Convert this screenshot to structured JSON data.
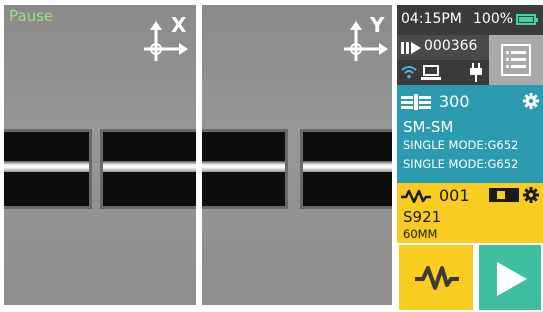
{
  "camera_x": {
    "status_label": "Pause",
    "axis_label": "X",
    "icon": "axis-cross-icon"
  },
  "camera_y": {
    "axis_label": "Y",
    "icon": "axis-cross-icon"
  },
  "status_bar": {
    "time": "04:15PM",
    "battery_percent": "100%",
    "battery_icon": "battery-full-icon",
    "colors": {
      "background": "#3b3b3b",
      "battery": "#3fd6a3"
    }
  },
  "info": {
    "splice_count": "000366",
    "counter_icon": "arc-counter-icon",
    "connection_icons": [
      "wifi-icon",
      "laptop-icon",
      "power-plug-icon"
    ]
  },
  "menu_button": {
    "icon": "menu-list-icon"
  },
  "splice_program": {
    "number": "300",
    "mode": "SM-SM",
    "left_fiber": "SINGLE MODE:G652",
    "right_fiber": "SINGLE MODE:G652",
    "icon": "splice-mode-icon",
    "settings_icon": "gear-icon",
    "color": "#2c9bb0"
  },
  "heater_program": {
    "number": "001",
    "name": "S921",
    "length": "60MM",
    "icon": "heat-wave-icon",
    "heater_icon": "heater-slot-icon",
    "settings_icon": "gear-icon",
    "color": "#f8cc21"
  },
  "buttons": {
    "heat_icon": "heat-wave-icon",
    "start_icon": "play-icon",
    "heat_color": "#f8cc21",
    "start_color": "#3fbfa0"
  }
}
